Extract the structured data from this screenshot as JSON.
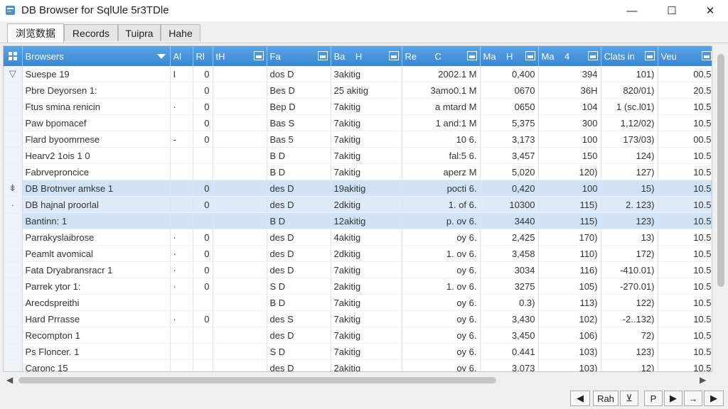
{
  "window": {
    "title": "DB Browser for SqlUle  5r3TDle",
    "min": "—",
    "max": "☐",
    "close": "✕"
  },
  "tabs": [
    {
      "label": "浏览数据",
      "active": true
    },
    {
      "label": "Records",
      "active": false
    },
    {
      "label": "Tuipra",
      "active": false
    },
    {
      "label": "Hahe",
      "active": false
    }
  ],
  "columns": [
    "Browsers",
    "Al",
    "Rl",
    "tH",
    "Fa",
    "Ba",
    "H",
    "Re",
    "C",
    "Ma",
    "H",
    "Ma",
    "4",
    "Clats in",
    "Veu"
  ],
  "rows": [
    {
      "marker": "▽",
      "c": [
        "Suespe 19",
        "I",
        "0",
        "dos D",
        "3akitig",
        "2002.1 M",
        "0,400",
        "394",
        "101)",
        "00.5"
      ]
    },
    {
      "marker": "",
      "c": [
        "Pbre Deyorsen 1:",
        "",
        "0",
        "Bes D",
        "25 akitig",
        "3amo0.1 M",
        "0670",
        "36H",
        "820/01)",
        "20.5"
      ]
    },
    {
      "marker": "",
      "c": [
        "Ftus smina renicin",
        "·",
        "0",
        "Bep D",
        "7akitig",
        "a mtard M",
        "0650",
        "104",
        "1 (sc.l01)",
        "10.5"
      ]
    },
    {
      "marker": "",
      "c": [
        "Paw bpomacef",
        "",
        "0",
        "Bas S",
        "7akitig",
        "1 and:1 M",
        "5,375",
        "300",
        "1,12/02)",
        "10.5"
      ]
    },
    {
      "marker": "",
      "c": [
        "Flard byoomrnese",
        "-",
        "0",
        "Bas 5",
        "7akitig",
        "10 6.",
        "3,173",
        "100",
        "173/03)",
        "00.5"
      ]
    },
    {
      "marker": "",
      "c": [
        "Hearv2 1ois 1 0",
        "",
        "",
        "B D",
        "7akitig",
        "fal:5 6.",
        "3,457",
        "150",
        "124)",
        "10.5"
      ]
    },
    {
      "marker": "",
      "c": [
        "Fabrveproncice",
        "",
        "",
        "B D",
        "7akitig",
        "aperz M",
        "5,020",
        "120)",
        "127)",
        "10.5"
      ]
    },
    {
      "marker": "⇟",
      "sel": "sel",
      "c": [
        "DB Brotnver amkse 1",
        "",
        "0",
        "des D",
        "19akitig",
        "pocti 6.",
        "0,420",
        "100",
        "15)",
        "10.5"
      ]
    },
    {
      "marker": "·",
      "sel": "sel2",
      "c": [
        "DB hajnal proorlal",
        "",
        "0",
        "des D",
        "2dkitig",
        "1. of 6.",
        "10300",
        "115)",
        "2. 123)",
        "10.5"
      ]
    },
    {
      "marker": "",
      "sel": "sel",
      "c": [
        "Bantinn: 1",
        "",
        "",
        "B D",
        "12akitig",
        "p. ov 6.",
        "3440",
        "115)",
        "123)",
        "10.5"
      ]
    },
    {
      "marker": "",
      "c": [
        "Parrakyslaibrose",
        "·",
        "0",
        "des D",
        "4akitig",
        "oy 6.",
        "2,425",
        "170)",
        "13)",
        "10.5"
      ]
    },
    {
      "marker": "",
      "c": [
        "Peamlt avomical",
        "·",
        "0",
        "des D",
        "2dkitig",
        "1. ov 6.",
        "3,458",
        "110)",
        "172)",
        "10.5"
      ]
    },
    {
      "marker": "",
      "c": [
        "Fata Dryabransracr 1",
        "·",
        "0",
        "des D",
        "7akitig",
        "oy 6.",
        "3034",
        "116)",
        "-410.01)",
        "10.5"
      ]
    },
    {
      "marker": "",
      "c": [
        "Parrek ytor 1:",
        "·",
        "0",
        "S D",
        "2akitig",
        "1. ov 6.",
        "3275",
        "105)",
        "-270.01)",
        "10.5"
      ]
    },
    {
      "marker": "",
      "c": [
        "Arecdspreithi",
        "",
        "",
        "B D",
        "7akitig",
        "oy 6.",
        "0.3)",
        "113)",
        "122)",
        "10.5"
      ]
    },
    {
      "marker": "",
      "c": [
        "Hard Prrasse",
        "·",
        "0",
        "des S",
        "7akitig",
        "oy 6.",
        "3,430",
        "102)",
        "-2..132)",
        "10.5"
      ]
    },
    {
      "marker": "",
      "c": [
        "Recompton 1",
        "",
        "",
        "des D",
        "7akitig",
        "oy 6.",
        "3,450",
        "106)",
        "72)",
        "10.5"
      ]
    },
    {
      "marker": "",
      "c": [
        "Ps Floncer. 1",
        "",
        "",
        "S D",
        "7akitig",
        "oy 6.",
        "0.441",
        "103)",
        "123)",
        "10.5"
      ]
    },
    {
      "marker": "",
      "c": [
        "Caronc 15",
        "",
        "",
        "des D",
        "2akitig",
        "oy 6.",
        "3,073",
        "103)",
        "12)",
        "10.5"
      ]
    }
  ],
  "nav": {
    "prev": "◀",
    "page_label": "Rah",
    "b3": "⊻",
    "b4": "P",
    "b5": "▶",
    "b6": "→",
    "next": "▶"
  },
  "colors": {
    "header_top": "#5ba3e4",
    "header_bottom": "#3a86d3",
    "selection": "#cfe2f6"
  }
}
